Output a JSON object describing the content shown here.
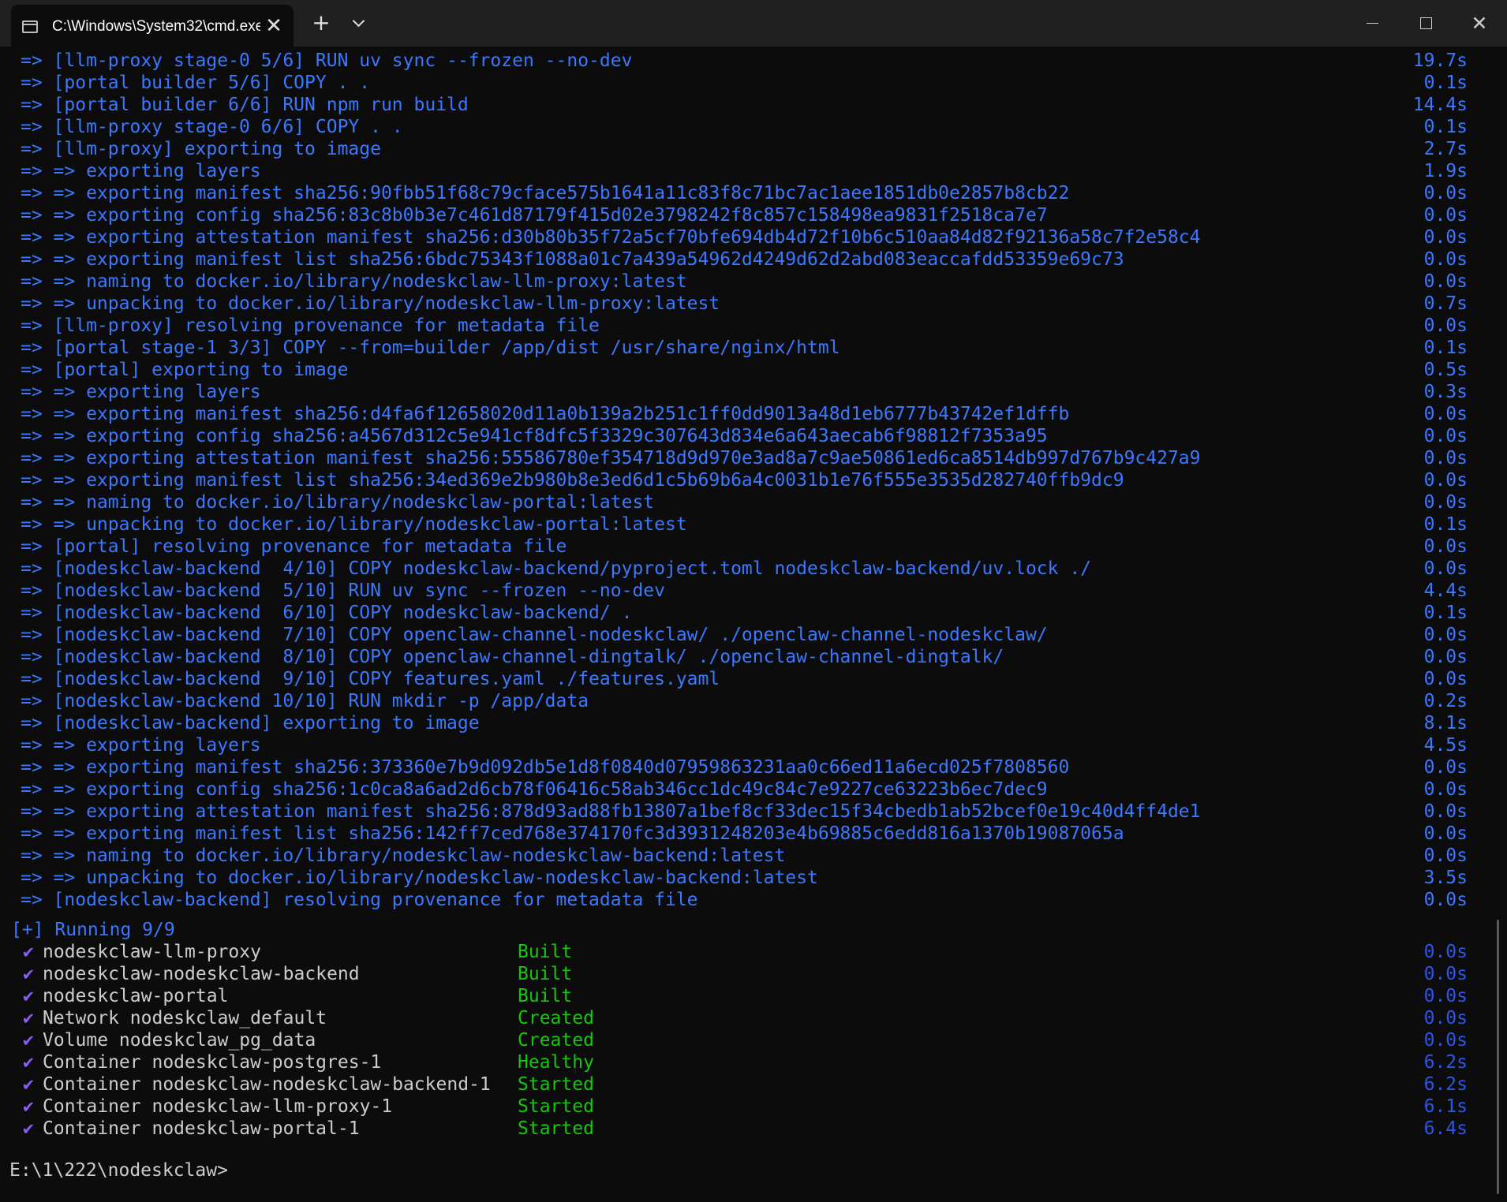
{
  "tab": {
    "title": "C:\\Windows\\System32\\cmd.exe",
    "icon": "terminal-icon"
  },
  "window": {
    "new_tab": "+",
    "close_tab": "✕",
    "close": "✕"
  },
  "colors": {
    "background": "#0c0c0c",
    "titlebar": "#202020",
    "log_text": "#3b78ff",
    "status_green": "#16c60c",
    "check_purple": "#8a5cf0",
    "running_blue": "#2d55e6"
  },
  "log": [
    {
      "text": "=> [llm-proxy stage-0 5/6] RUN uv sync --frozen --no-dev",
      "time": "19.7s"
    },
    {
      "text": "=> [portal builder 5/6] COPY . .",
      "time": "0.1s"
    },
    {
      "text": "=> [portal builder 6/6] RUN npm run build",
      "time": "14.4s"
    },
    {
      "text": "=> [llm-proxy stage-0 6/6] COPY . .",
      "time": "0.1s"
    },
    {
      "text": "=> [llm-proxy] exporting to image",
      "time": "2.7s"
    },
    {
      "text": "=> => exporting layers",
      "time": "1.9s"
    },
    {
      "text": "=> => exporting manifest sha256:90fbb51f68c79cface575b1641a11c83f8c71bc7ac1aee1851db0e2857b8cb22",
      "time": "0.0s"
    },
    {
      "text": "=> => exporting config sha256:83c8b0b3e7c461d87179f415d02e3798242f8c857c158498ea9831f2518ca7e7",
      "time": "0.0s"
    },
    {
      "text": "=> => exporting attestation manifest sha256:d30b80b35f72a5cf70bfe694db4d72f10b6c510aa84d82f92136a58c7f2e58c4",
      "time": "0.0s"
    },
    {
      "text": "=> => exporting manifest list sha256:6bdc75343f1088a01c7a439a54962d4249d62d2abd083eaccafdd53359e69c73",
      "time": "0.0s"
    },
    {
      "text": "=> => naming to docker.io/library/nodeskclaw-llm-proxy:latest",
      "time": "0.0s"
    },
    {
      "text": "=> => unpacking to docker.io/library/nodeskclaw-llm-proxy:latest",
      "time": "0.7s"
    },
    {
      "text": "=> [llm-proxy] resolving provenance for metadata file",
      "time": "0.0s"
    },
    {
      "text": "=> [portal stage-1 3/3] COPY --from=builder /app/dist /usr/share/nginx/html",
      "time": "0.1s"
    },
    {
      "text": "=> [portal] exporting to image",
      "time": "0.5s"
    },
    {
      "text": "=> => exporting layers",
      "time": "0.3s"
    },
    {
      "text": "=> => exporting manifest sha256:d4fa6f12658020d11a0b139a2b251c1ff0dd9013a48d1eb6777b43742ef1dffb",
      "time": "0.0s"
    },
    {
      "text": "=> => exporting config sha256:a4567d312c5e941cf8dfc5f3329c307643d834e6a643aecab6f98812f7353a95",
      "time": "0.0s"
    },
    {
      "text": "=> => exporting attestation manifest sha256:55586780ef354718d9d970e3ad8a7c9ae50861ed6ca8514db997d767b9c427a9",
      "time": "0.0s"
    },
    {
      "text": "=> => exporting manifest list sha256:34ed369e2b980b8e3ed6d1c5b69b6a4c0031b1e76f555e3535d282740ffb9dc9",
      "time": "0.0s"
    },
    {
      "text": "=> => naming to docker.io/library/nodeskclaw-portal:latest",
      "time": "0.0s"
    },
    {
      "text": "=> => unpacking to docker.io/library/nodeskclaw-portal:latest",
      "time": "0.1s"
    },
    {
      "text": "=> [portal] resolving provenance for metadata file",
      "time": "0.0s"
    },
    {
      "text": "=> [nodeskclaw-backend  4/10] COPY nodeskclaw-backend/pyproject.toml nodeskclaw-backend/uv.lock ./",
      "time": "0.0s"
    },
    {
      "text": "=> [nodeskclaw-backend  5/10] RUN uv sync --frozen --no-dev",
      "time": "4.4s"
    },
    {
      "text": "=> [nodeskclaw-backend  6/10] COPY nodeskclaw-backend/ .",
      "time": "0.1s"
    },
    {
      "text": "=> [nodeskclaw-backend  7/10] COPY openclaw-channel-nodeskclaw/ ./openclaw-channel-nodeskclaw/",
      "time": "0.0s"
    },
    {
      "text": "=> [nodeskclaw-backend  8/10] COPY openclaw-channel-dingtalk/ ./openclaw-channel-dingtalk/",
      "time": "0.0s"
    },
    {
      "text": "=> [nodeskclaw-backend  9/10] COPY features.yaml ./features.yaml",
      "time": "0.0s"
    },
    {
      "text": "=> [nodeskclaw-backend 10/10] RUN mkdir -p /app/data",
      "time": "0.2s"
    },
    {
      "text": "=> [nodeskclaw-backend] exporting to image",
      "time": "8.1s"
    },
    {
      "text": "=> => exporting layers",
      "time": "4.5s"
    },
    {
      "text": "=> => exporting manifest sha256:373360e7b9d092db5e1d8f0840d07959863231aa0c66ed11a6ecd025f7808560",
      "time": "0.0s"
    },
    {
      "text": "=> => exporting config sha256:1c0ca8a6ad2d6cb78f06416c58ab346cc1dc49c84c7e9227ce63223b6ec7dec9",
      "time": "0.0s"
    },
    {
      "text": "=> => exporting attestation manifest sha256:878d93ad88fb13807a1bef8cf33dec15f34cbedb1ab52bcef0e19c40d4ff4de1",
      "time": "0.0s"
    },
    {
      "text": "=> => exporting manifest list sha256:142ff7ced768e374170fc3d3931248203e4b69885c6edd816a1370b19087065a",
      "time": "0.0s"
    },
    {
      "text": "=> => naming to docker.io/library/nodeskclaw-nodeskclaw-backend:latest",
      "time": "0.0s"
    },
    {
      "text": "=> => unpacking to docker.io/library/nodeskclaw-nodeskclaw-backend:latest",
      "time": "3.5s"
    },
    {
      "text": "=> [nodeskclaw-backend] resolving provenance for metadata file",
      "time": "0.0s"
    }
  ],
  "running_header": "[+] Running 9/9",
  "services": [
    {
      "check": "✔",
      "name": "nodeskclaw-llm-proxy",
      "status": "Built",
      "time": "0.0s"
    },
    {
      "check": "✔",
      "name": "nodeskclaw-nodeskclaw-backend",
      "status": "Built",
      "time": "0.0s"
    },
    {
      "check": "✔",
      "name": "nodeskclaw-portal",
      "status": "Built",
      "time": "0.0s"
    },
    {
      "check": "✔",
      "name": "Network nodeskclaw_default",
      "status": "Created",
      "time": "0.0s"
    },
    {
      "check": "✔",
      "name": "Volume nodeskclaw_pg_data",
      "status": "Created",
      "time": "0.0s"
    },
    {
      "check": "✔",
      "name": "Container nodeskclaw-postgres-1",
      "status": "Healthy",
      "time": "6.2s"
    },
    {
      "check": "✔",
      "name": "Container nodeskclaw-nodeskclaw-backend-1",
      "status": "Started",
      "time": "6.2s"
    },
    {
      "check": "✔",
      "name": "Container nodeskclaw-llm-proxy-1",
      "status": "Started",
      "time": "6.1s"
    },
    {
      "check": "✔",
      "name": "Container nodeskclaw-portal-1",
      "status": "Started",
      "time": "6.4s"
    }
  ],
  "prompt": "E:\\1\\222\\nodeskclaw>"
}
